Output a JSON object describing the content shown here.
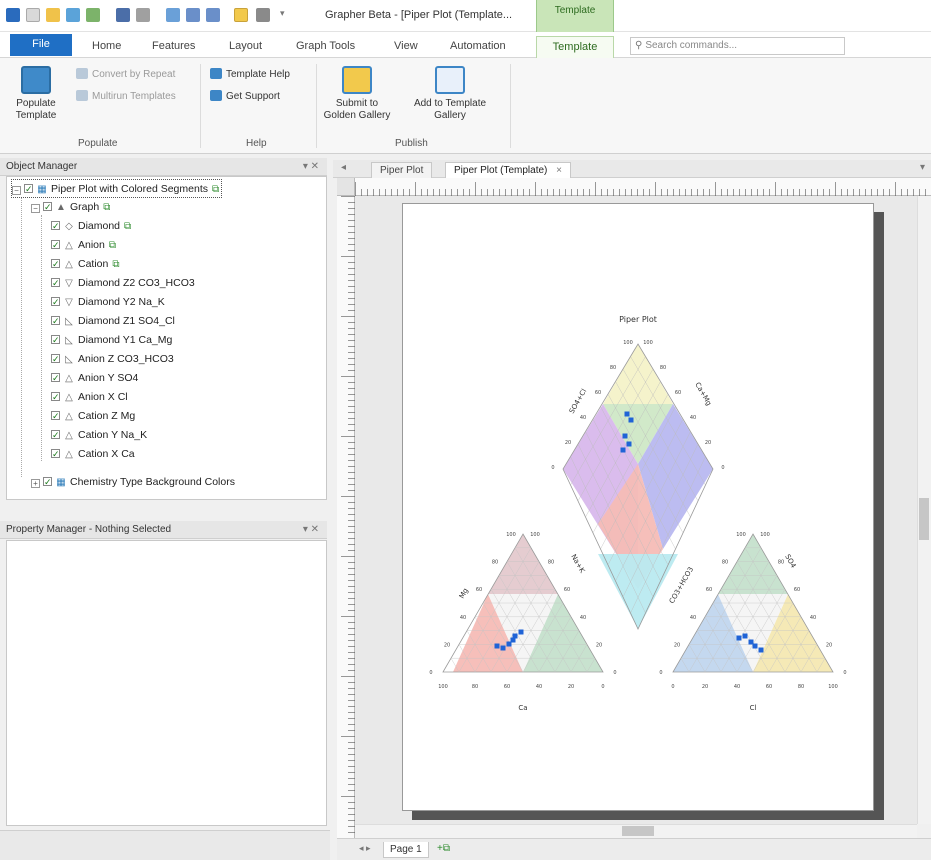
{
  "app": {
    "title": "Grapher Beta - [Piper Plot (Template...",
    "context_tab_group": "Template"
  },
  "ribbon_tabs": [
    {
      "label": "File"
    },
    {
      "label": "Home"
    },
    {
      "label": "Features"
    },
    {
      "label": "Layout"
    },
    {
      "label": "Graph Tools"
    },
    {
      "label": "View"
    },
    {
      "label": "Automation"
    },
    {
      "label": "Template"
    }
  ],
  "search": {
    "placeholder": "Search commands..."
  },
  "ribbon": {
    "populate_template": "Populate Template",
    "convert_by_repeat": "Convert by Repeat",
    "multirun_templates": "Multirun Templates",
    "template_help": "Template Help",
    "get_support": "Get Support",
    "submit_golden_gallery": "Submit to Golden Gallery",
    "add_template_gallery": "Add to Template Gallery",
    "groups": {
      "populate": "Populate",
      "help": "Help",
      "publish": "Publish"
    }
  },
  "object_manager": {
    "title": "Object Manager",
    "items": [
      {
        "label": "Piper Plot with Colored Segments"
      },
      {
        "label": "Graph"
      },
      {
        "label": "Diamond"
      },
      {
        "label": "Anion"
      },
      {
        "label": "Cation"
      },
      {
        "label": "Diamond Z2 CO3_HCO3"
      },
      {
        "label": "Diamond Y2 Na_K"
      },
      {
        "label": "Diamond Z1 SO4_Cl"
      },
      {
        "label": "Diamond Y1 Ca_Mg"
      },
      {
        "label": "Anion Z CO3_HCO3"
      },
      {
        "label": "Anion Y SO4"
      },
      {
        "label": "Anion X Cl"
      },
      {
        "label": "Cation Z Mg"
      },
      {
        "label": "Cation Y Na_K"
      },
      {
        "label": "Cation X Ca"
      },
      {
        "label": "Chemistry Type Background Colors"
      }
    ]
  },
  "property_manager": {
    "title": "Property Manager - Nothing Selected"
  },
  "doc_tabs": [
    {
      "label": "Piper Plot"
    },
    {
      "label": "Piper Plot (Template)"
    }
  ],
  "page_tabs": {
    "page1": "Page 1"
  },
  "plot": {
    "title": "Piper Plot",
    "labels": {
      "so4_cl": "SO4+Cl",
      "ca_mg": "Ca+Mg",
      "mg": "Mg",
      "na_k": "Na+K",
      "co3": "CO3+HCO3",
      "so4": "SO4",
      "ca": "Ca",
      "cl": "Cl"
    },
    "ticks": [
      "0",
      "20",
      "40",
      "60",
      "80",
      "100"
    ],
    "colors": {
      "yellow": "#f4f2c8",
      "green": "#cfe8c6",
      "purple": "#d8b8ec",
      "blue": "#b8b8f0",
      "red": "#f5bcb6",
      "cyan": "#b9eaf0",
      "pink": "#e4c9cd",
      "teal": "#c5e0cc",
      "lightblue": "#c1d6ee",
      "lightyellow": "#f4e8b2",
      "points": "#1f63d6"
    }
  }
}
